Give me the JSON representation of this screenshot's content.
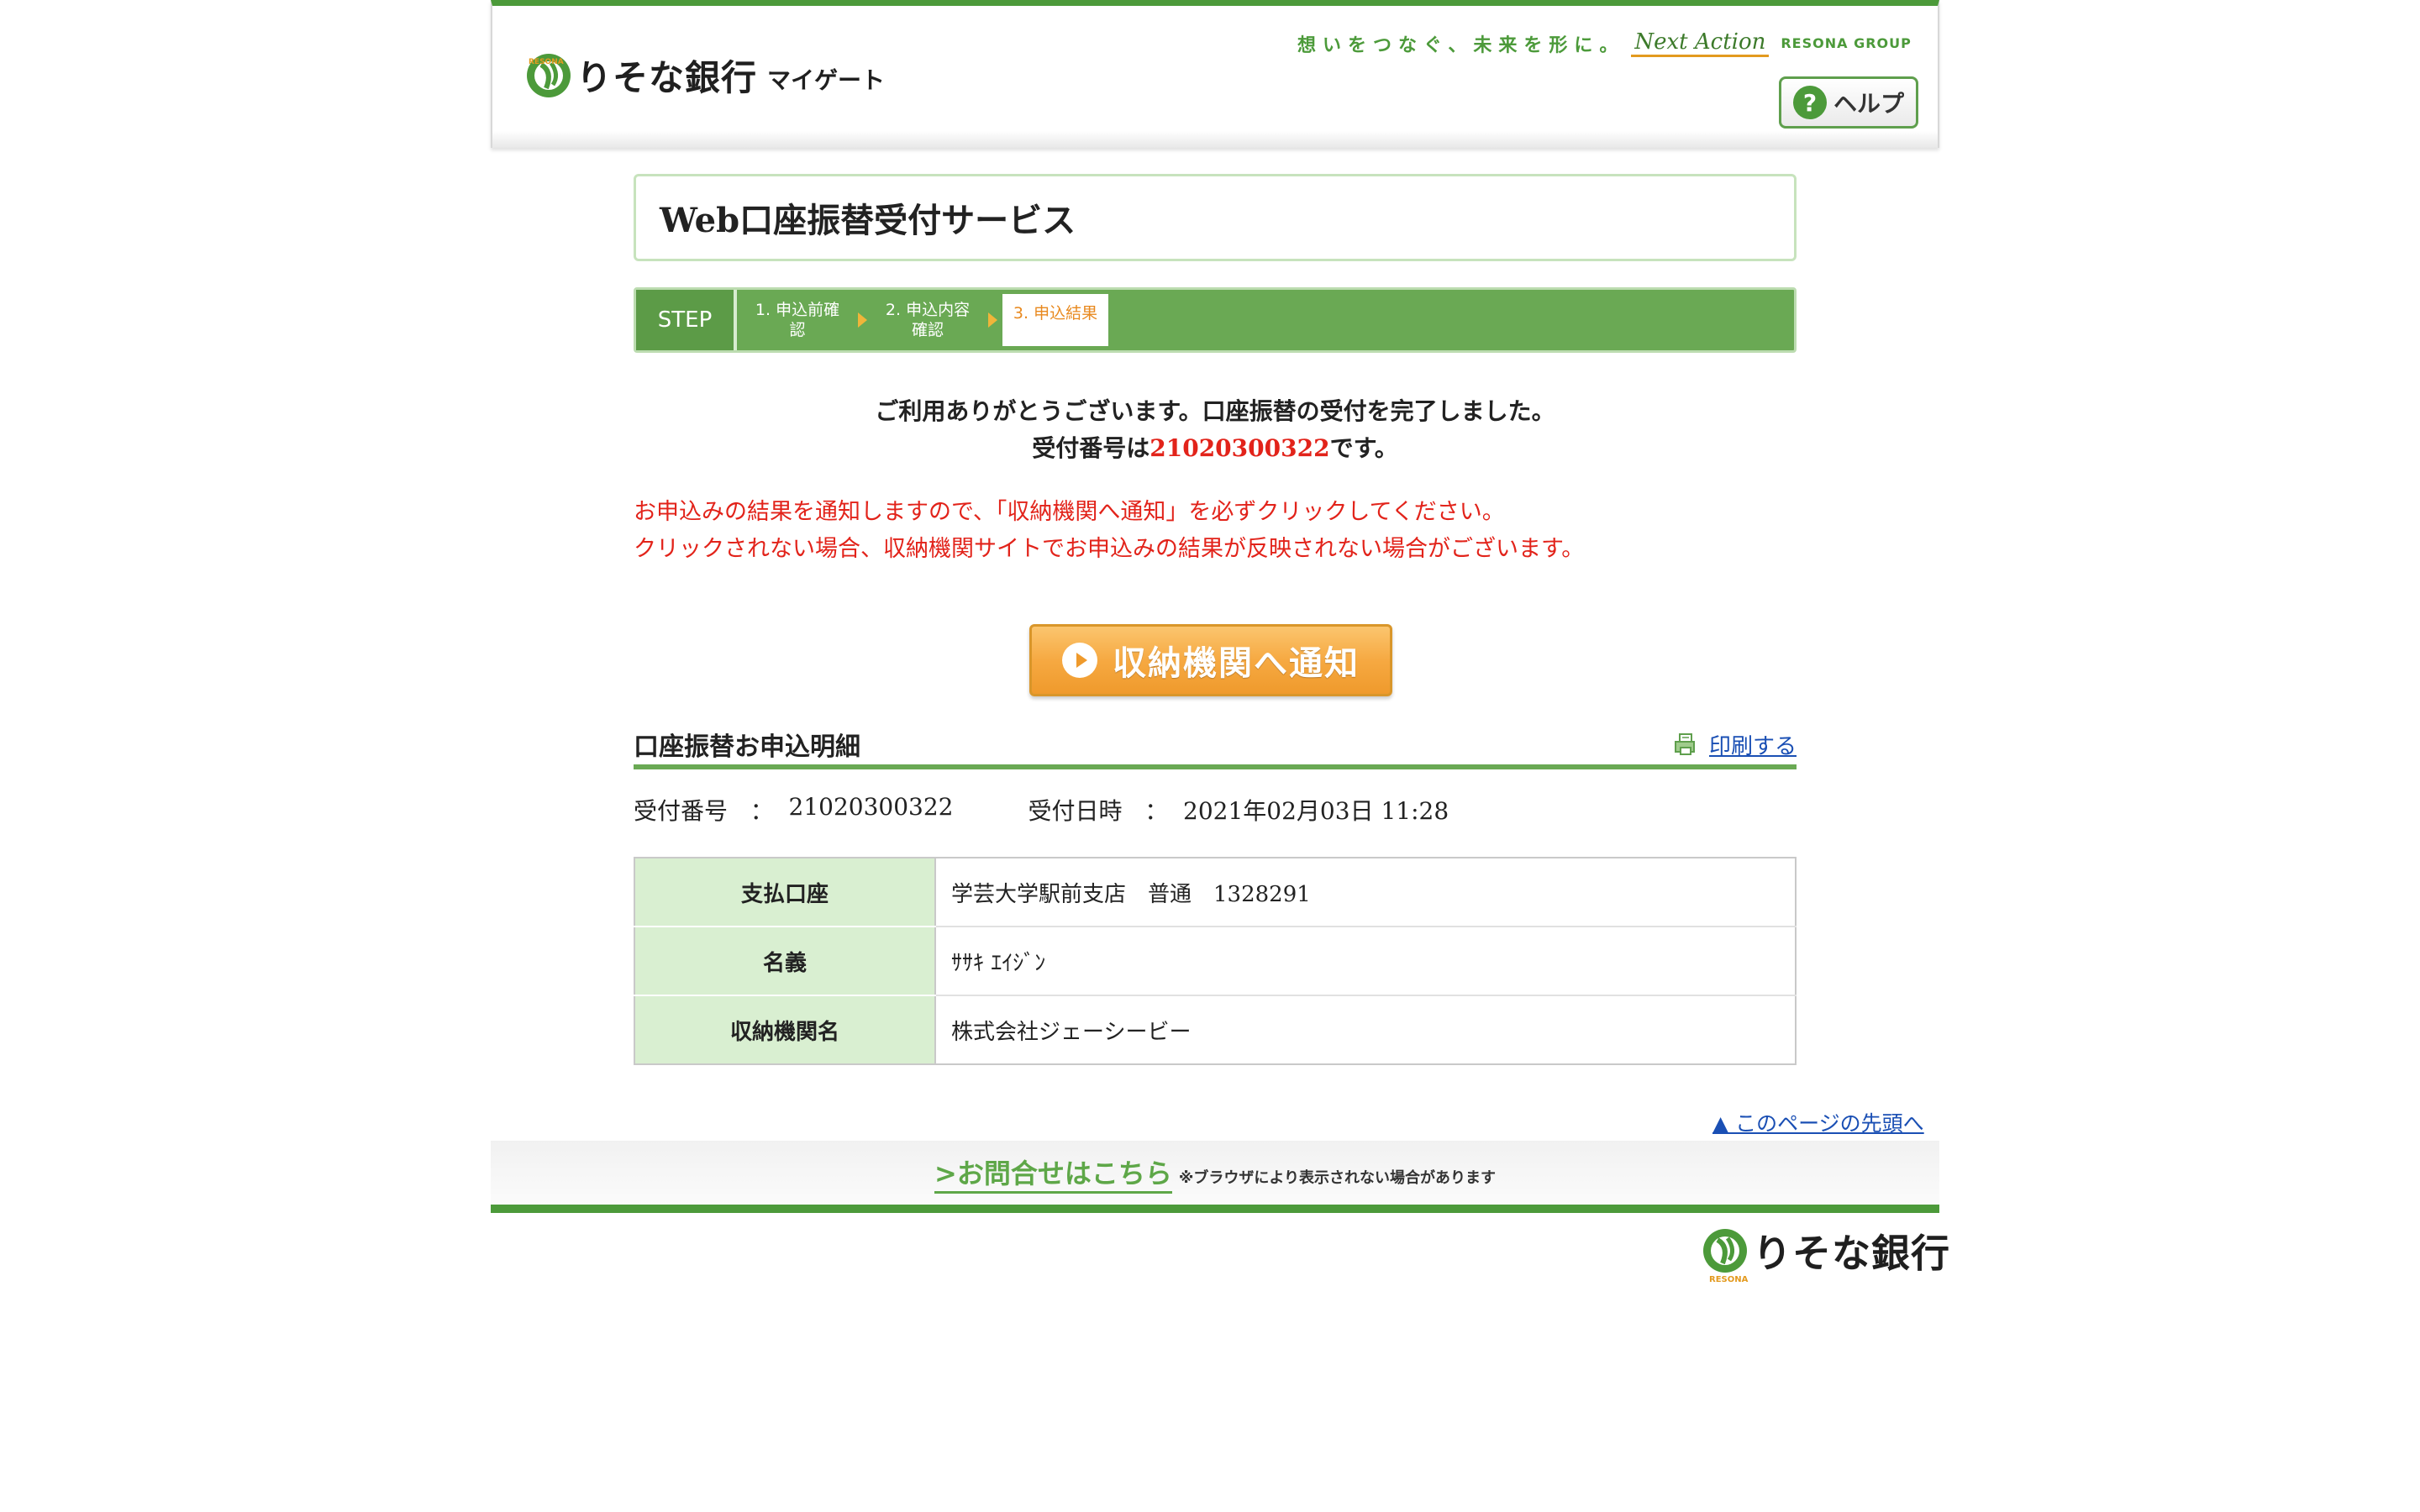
{
  "header": {
    "bank_name": "りそな銀行",
    "service_name": "マイゲート",
    "logo_caption": "RESONA",
    "slogan": "想いをつなぐ、未来を形に。",
    "slogan_brand": "Next Action",
    "group_name": "RESONA GROUP",
    "help_label": "ヘルプ"
  },
  "page_title": "Web口座振替受付サービス",
  "steps": {
    "label": "STEP",
    "items": [
      "1. 申込前確認",
      "2. 申込内容確認",
      "3. 申込結果"
    ]
  },
  "message": {
    "thanks": "ご利用ありがとうございます。口座振替の受付を完了しました。",
    "receipt_prefix": "受付番号は",
    "receipt_number": "21020300322",
    "receipt_suffix": "です。",
    "warning_line1": "お申込みの結果を通知しますので、「収納機関へ通知」を必ずクリックしてください。",
    "warning_line2": "クリックされない場合、収納機関サイトでお申込みの結果が反映されない場合がございます。"
  },
  "notify_button": "収納機関へ通知",
  "detail": {
    "title": "口座振替お申込明細",
    "print_label": "印刷する",
    "receipt_label": "受付番号",
    "receipt_value": "21020300322",
    "datetime_label": "受付日時",
    "datetime_value": "2021年02月03日 11:28",
    "rows": [
      {
        "label": "支払口座",
        "value": "学芸大学駅前支店　普通　1328291"
      },
      {
        "label": "名義",
        "value": "ｻｻｷ ｴｲｼﾞﾝ"
      },
      {
        "label": "収納機関名",
        "value": "株式会社ジェーシービー"
      }
    ]
  },
  "to_top": "▲ このページの先頭へ",
  "footer": {
    "contact_label": ">お問合せはこちら",
    "contact_note": "※ブラウザにより表示されない場合があります",
    "bank_name": "りそな銀行",
    "logo_caption": "RESONA"
  },
  "colors": {
    "brand_green": "#4c9a3a",
    "step_green": "#6aa954",
    "accent_orange": "#ef9a2c",
    "alert_red": "#e2231a",
    "link_blue": "#1a4fb4"
  }
}
